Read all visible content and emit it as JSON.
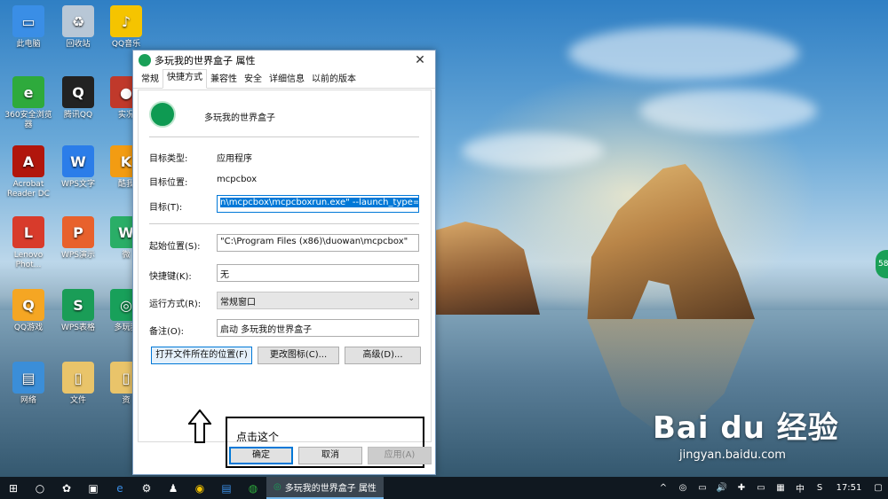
{
  "desktop_icons": [
    {
      "label": "此电脑",
      "color": "#3a8ee6",
      "glyph": "▭"
    },
    {
      "label": "回收站",
      "color": "#b8c7d6",
      "glyph": "♻"
    },
    {
      "label": "QQ音乐",
      "color": "#f5c400",
      "glyph": "♪"
    },
    {
      "label": "360安全浏览器",
      "color": "#2eaa3c",
      "glyph": "e"
    },
    {
      "label": "腾讯QQ",
      "color": "#222222",
      "glyph": "Q"
    },
    {
      "label": "实况",
      "color": "#c0392b",
      "glyph": "●"
    },
    {
      "label": "Acrobat Reader DC",
      "color": "#b1160c",
      "glyph": "A"
    },
    {
      "label": "WPS文字",
      "color": "#2b7de9",
      "glyph": "W"
    },
    {
      "label": "酷我",
      "color": "#f39c12",
      "glyph": "K"
    },
    {
      "label": "Lenovo Phot...",
      "color": "#d83b2b",
      "glyph": "L"
    },
    {
      "label": "WPS演示",
      "color": "#e8612c",
      "glyph": "P"
    },
    {
      "label": "微",
      "color": "#2aae67",
      "glyph": "W"
    },
    {
      "label": "QQ游戏",
      "color": "#f5a623",
      "glyph": "Q"
    },
    {
      "label": "WPS表格",
      "color": "#1a9d57",
      "glyph": "S"
    },
    {
      "label": "多玩我",
      "color": "#18a05a",
      "glyph": "◎"
    },
    {
      "label": "网络",
      "color": "#3b8ed8",
      "glyph": "▤"
    },
    {
      "label": "文件",
      "color": "#e9c46a",
      "glyph": "▯"
    },
    {
      "label": "资",
      "color": "#e9c46a",
      "glyph": "▯"
    }
  ],
  "dialog": {
    "title": "多玩我的世界盒子 属性",
    "close_glyph": "✕",
    "tabs": [
      "常规",
      "快捷方式",
      "兼容性",
      "安全",
      "详细信息",
      "以前的版本"
    ],
    "app_name": "多玩我的世界盒子",
    "fields": {
      "target_type_label": "目标类型:",
      "target_type_value": "应用程序",
      "target_location_label": "目标位置:",
      "target_location_value": "mcpcbox",
      "target_label": "目标(T):",
      "target_value": "n\\mcpcbox\\mcpcboxrun.exe\" --launch_type=desk",
      "start_in_label": "起始位置(S):",
      "start_in_value": "\"C:\\Program Files (x86)\\duowan\\mcpcbox\"",
      "shortcut_key_label": "快捷键(K):",
      "shortcut_key_value": "无",
      "run_label": "运行方式(R):",
      "run_value": "常规窗口",
      "comment_label": "备注(O):",
      "comment_value": "启动 多玩我的世界盒子"
    },
    "buttons": {
      "open_location": "打开文件所在的位置(F)",
      "change_icon": "更改图标(C)...",
      "advanced": "高级(D)...",
      "ok": "确定",
      "cancel": "取消",
      "apply": "应用(A)"
    },
    "callout_text": "点击这个"
  },
  "side_badge": "58",
  "watermark": {
    "logo": "Bai du 经验",
    "url": "jingyan.baidu.com"
  },
  "taskbar": {
    "active_window": "多玩我的世界盒子 属性",
    "time": "17:51",
    "tray_icons": [
      "^",
      "◎",
      "▭",
      "🔊",
      "✚",
      "▭",
      "▦",
      "中",
      "S"
    ]
  }
}
